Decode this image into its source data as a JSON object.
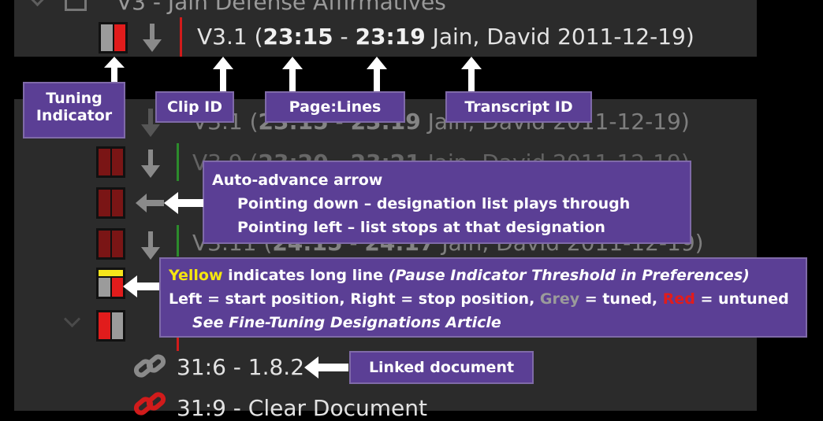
{
  "header": {
    "title": "V3 - Jain Defense Affirmatives"
  },
  "clip_row": {
    "clip_id": "V3.1",
    "start": "23:15",
    "end": "23:19",
    "transcript": "Jain, David 2011-12-19"
  },
  "callouts": {
    "tuning_indicator_line1": "Tuning",
    "tuning_indicator_line2": "Indicator",
    "clip_id": "Clip ID",
    "page_lines": "Page:Lines",
    "transcript_id": "Transcript ID",
    "auto_advance_title": "Auto-advance arrow",
    "auto_advance_down": "Pointing down – designation list plays through",
    "auto_advance_left": "Pointing left – list stops at that designation",
    "yellow_word": "Yellow",
    "yellow_rest": " indicates long line ",
    "yellow_paren": "(Pause Indicator Threshold in Preferences)",
    "lr_line_a": "Left = start position, Right = stop position, ",
    "grey_word": "Grey",
    "lr_line_b": " = tuned, ",
    "red_word": "Red",
    "lr_line_c": " = untuned",
    "see_article": "See Fine-Tuning Designations Article",
    "linked_document": "Linked document"
  },
  "list_rows": [
    {
      "clip_id": "V3.1",
      "start": "23:15",
      "end": "23:19",
      "transcript": "Jain, David 2011-12-19"
    },
    {
      "clip_id": "V3.9",
      "start": "23:20",
      "end": "23:21",
      "transcript": "Jain, David 2011-12-19"
    },
    {
      "clip_id": "V3.11",
      "start": "24:15",
      "end": "24:17",
      "transcript": "Jain, David 2011-12-19"
    }
  ],
  "documents": [
    {
      "label": "31:6 - 1.8.2"
    },
    {
      "label": "31:9 - Clear Document"
    }
  ],
  "colors": {
    "callout_bg": "#5b3f95",
    "yellow": "#f5e60f",
    "untuned_red": "#e11c1c",
    "tuned_grey": "#9b9b9b"
  }
}
